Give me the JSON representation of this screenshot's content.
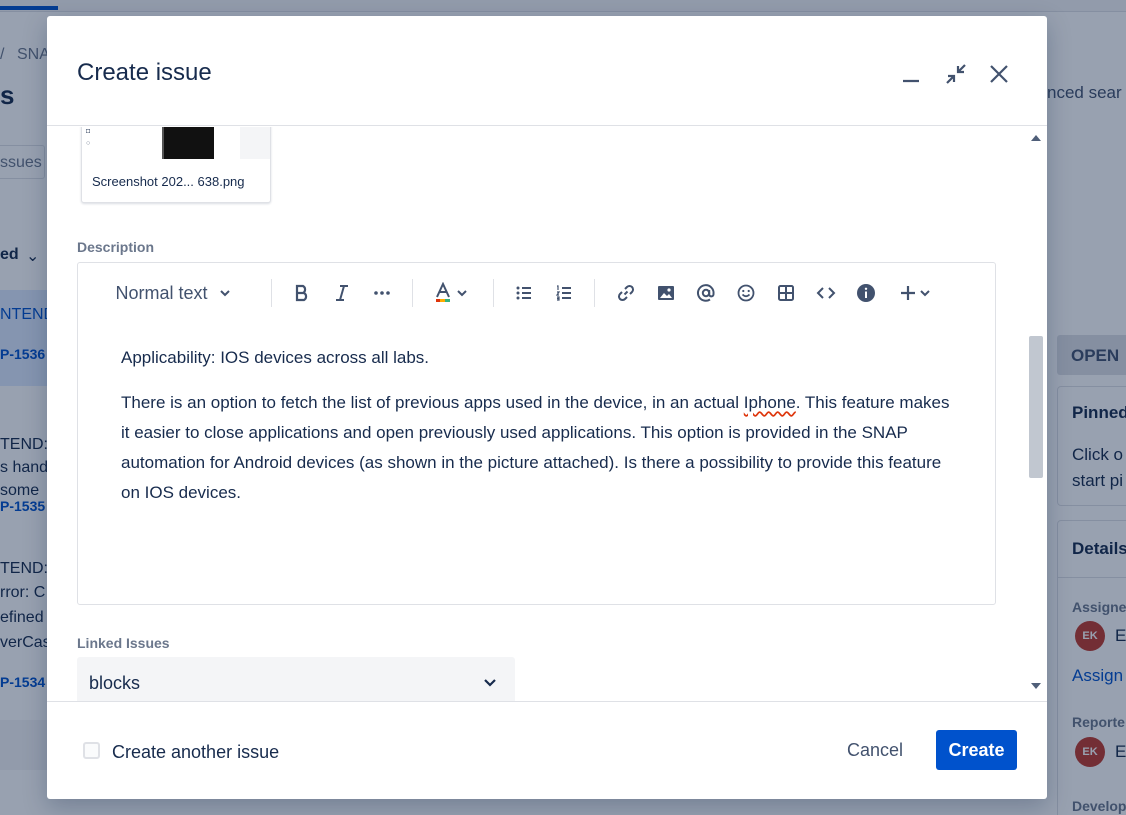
{
  "background": {
    "breadcrumb_sep": "/",
    "breadcrumb_project": "SNA",
    "heading_partial": "s",
    "search_placeholder_partial": "ssues",
    "filter_partial": "ed",
    "issues": [
      {
        "title_partial": "NTEND",
        "key_partial": "P-1536"
      },
      {
        "title_partial": "TEND: D",
        "line2": "s hand",
        "line3": "some",
        "key_partial": "P-1535"
      },
      {
        "title_partial": "TEND:",
        "line2": "rror: C",
        "line3": "efined",
        "line4": "verCas",
        "key_partial": "P-1534"
      }
    ],
    "right": {
      "advanced_search_partial": "nced sear",
      "status": "OPEN",
      "pinned_title": "Pinned",
      "pinned_line1": "Click o",
      "pinned_line2": "start pi",
      "details_title": "Details",
      "assignee_label": "Assigne",
      "assignee_initials": "EK",
      "assignee_name_partial": "E",
      "assign_link_partial": "Assign",
      "reporter_label": "Reporte",
      "reporter_initials": "EK",
      "reporter_name_partial": "E",
      "development_label": "Develop"
    }
  },
  "modal": {
    "title": "Create issue",
    "attachment": {
      "filename": "Screenshot 202... 638.png"
    },
    "description": {
      "label": "Description",
      "toolbar": {
        "text_style": "Normal text"
      },
      "paragraph1": "Applicability: IOS devices across all labs.",
      "paragraph2_before": "There is an option to fetch the list of previous apps used in the device, in an actual ",
      "paragraph2_misspelled": "Iphone",
      "paragraph2_after": ". This feature makes it easier to close applications and open previously used applications. This option is provided in the SNAP automation for Android devices (as shown in the picture attached). Is there a possibility to provide this feature on IOS devices."
    },
    "linked_issues": {
      "label": "Linked Issues",
      "selected": "blocks"
    },
    "footer": {
      "create_another_label": "Create another issue",
      "cancel_label": "Cancel",
      "create_label": "Create"
    }
  },
  "colors": {
    "primary": "#0052cc",
    "overlay": "#091e42",
    "text": "#172b4d",
    "subtle_text": "#6b778c",
    "avatar": "#c0392b"
  }
}
